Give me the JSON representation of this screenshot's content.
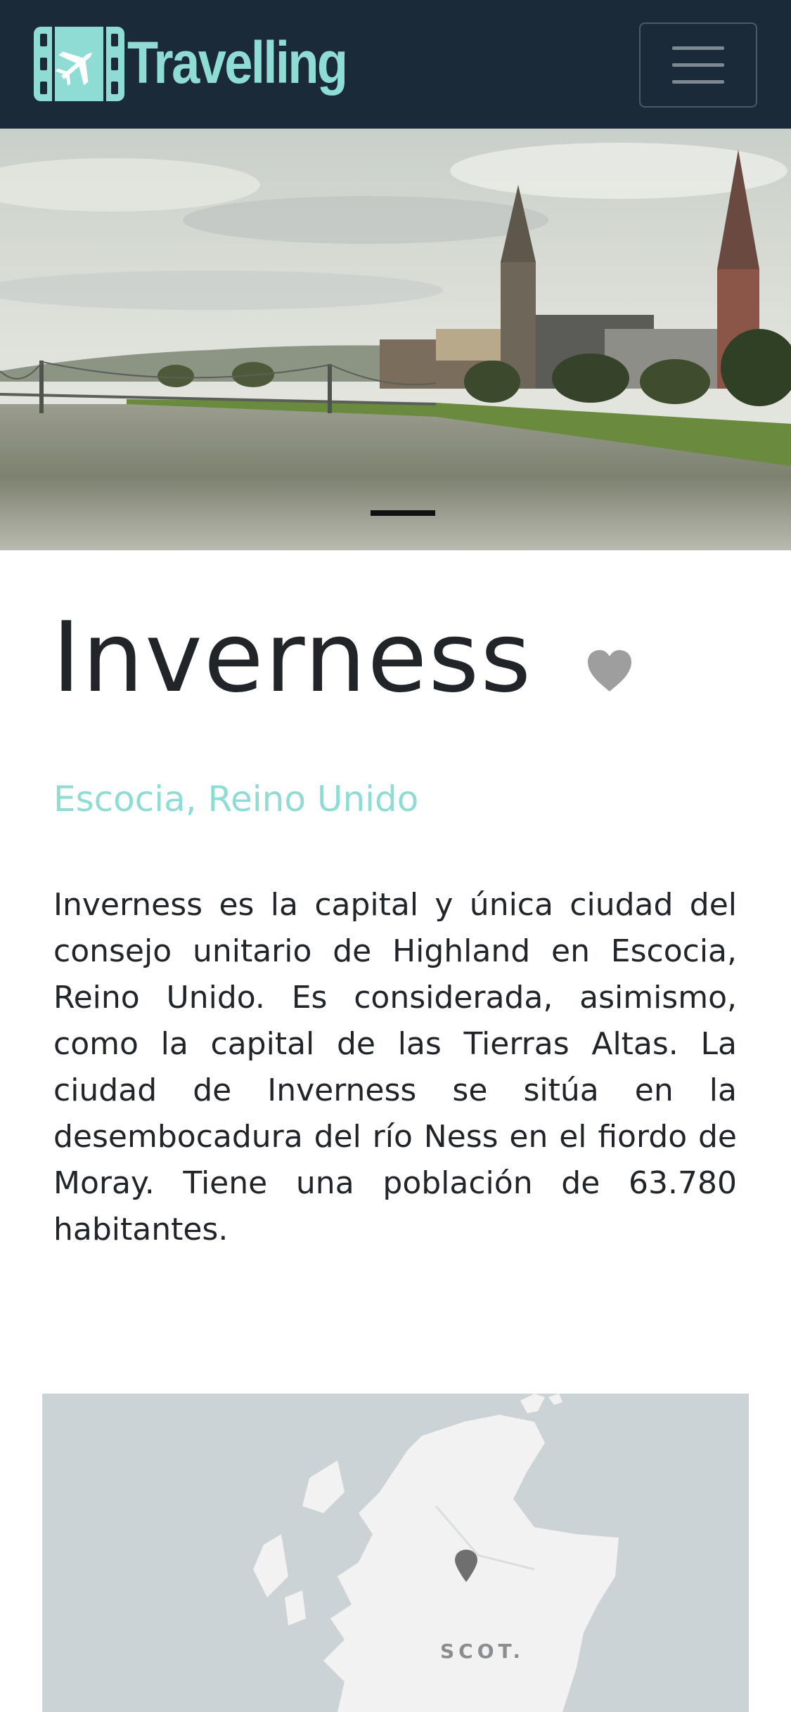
{
  "navbar": {
    "brand": "Travelling",
    "logo_icon": "plane-film-icon",
    "menu_icon": "hamburger-icon",
    "colors": {
      "background": "#1b2a38",
      "brand": "#8fdcd4"
    }
  },
  "hero": {
    "alt": "Inverness",
    "carousel": {
      "active_index": 0,
      "count": 1
    }
  },
  "destination": {
    "title": "Inverness",
    "favorite_icon": "heart-icon",
    "location": "Escocia, Reino Unido",
    "description": "Inverness es la capital y única ciudad del consejo unitario de Highland en Escocia, Reino Unido. Es considerada, asimismo, como la capital de las Tierras Altas. La ciudad de Inverness se sitúa en la desembocadura del río Ness en el fiordo de Moray. Tiene una población de 63.780 habitantes."
  },
  "map": {
    "region_label": "SCOT.",
    "pin_icon": "map-pin-icon",
    "colors": {
      "water": "#ccd3d6",
      "land": "#f2f2f2",
      "pin": "#6f6f6f"
    }
  }
}
